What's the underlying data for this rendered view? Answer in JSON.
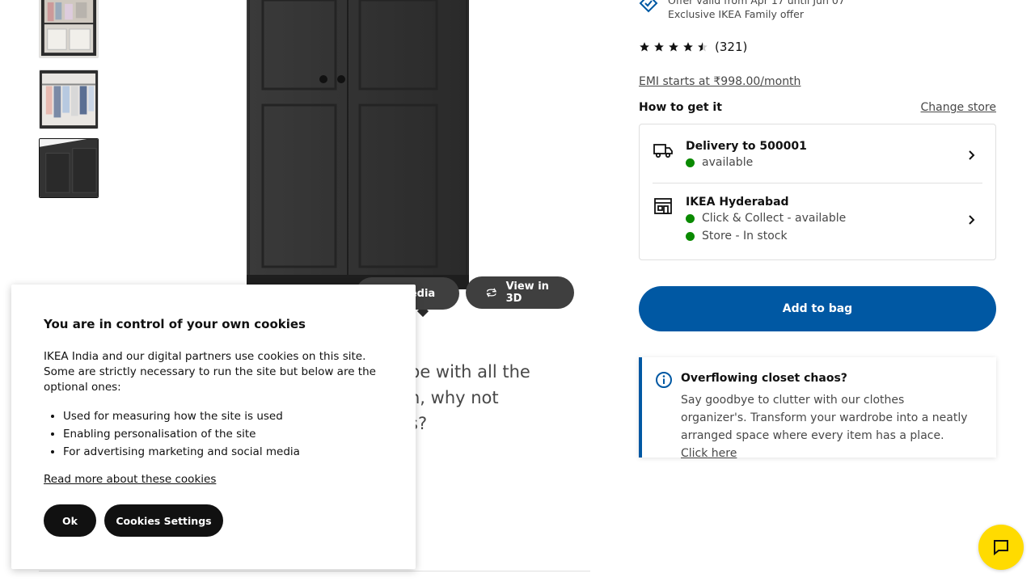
{
  "offer": {
    "line1": "Offer valid from Apr 17 until Jun 07",
    "line2": "Exclusive IKEA Family offer"
  },
  "rating": {
    "stars": 4.5,
    "count": "(321)"
  },
  "emi": "EMI starts at ₹998.00/month",
  "how_to_get": {
    "title": "How to get it",
    "change_store": "Change store"
  },
  "availability": {
    "delivery": {
      "title": "Delivery to 500001",
      "status": "available"
    },
    "store": {
      "title": "IKEA Hyderabad",
      "click_collect": "Click & Collect - available",
      "stock": "Store - In stock"
    }
  },
  "add_to_bag": "Add to bag",
  "media": {
    "media_label": "All media",
    "view3d_label": "View in 3D"
  },
  "description": {
    "l1": "be with all the",
    "l2": "n, why not",
    "l3": "s?"
  },
  "promo": {
    "title": "Overflowing closet chaos?",
    "body": "Say goodbye to clutter with our clothes organizer's. Transform your wardrobe into a neatly arranged space where every item has a place. ",
    "link": "Click here"
  },
  "cookie": {
    "heading": "You are in control of your own cookies",
    "intro": "IKEA India and our digital partners use cookies on this site. Some are strictly necessary to run the site but below are the optional ones:",
    "items": [
      "Used for measuring how the site is used",
      "Enabling personalisation of the site",
      "For advertising marketing and social media"
    ],
    "read_more": "Read more about these cookies",
    "ok": "Ok",
    "settings": "Cookies Settings"
  },
  "colors": {
    "accent_blue": "#0058a3",
    "stock_green": "#0a8a00",
    "chat_yellow": "#ffdb00"
  }
}
